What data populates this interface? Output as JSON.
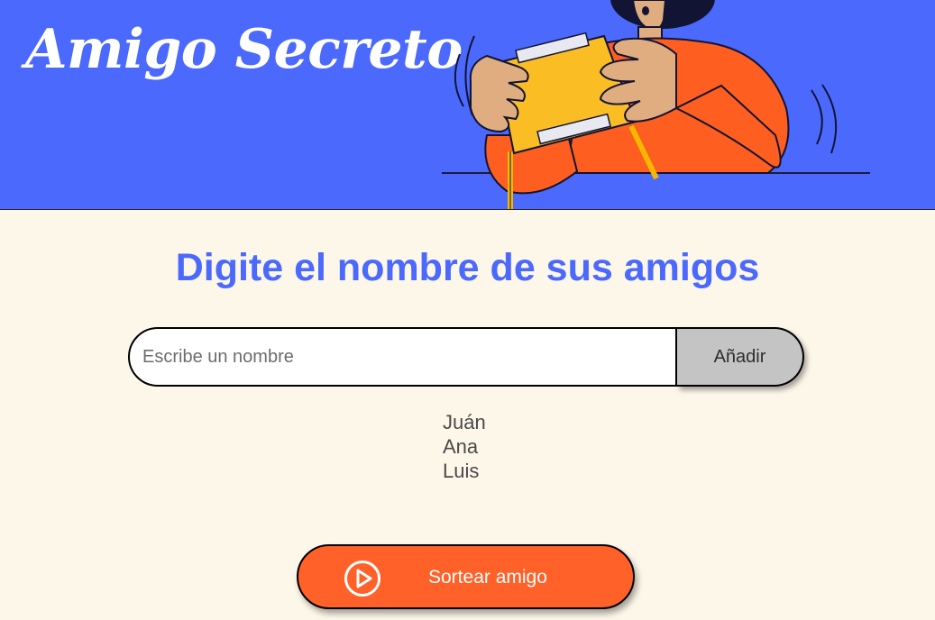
{
  "header": {
    "title": "Amigo Secreto",
    "illustration_icon": "person-holding-gift-illustration",
    "background_color": "#4b69fd"
  },
  "main": {
    "heading": "Digite el nombre de sus amigos",
    "heading_color": "#4b69fd",
    "input": {
      "value": "",
      "placeholder": "Escribe un nombre"
    },
    "add_button_label": "Añadir",
    "friends": [
      "Juán",
      "Ana",
      "Luis"
    ],
    "draw_button": {
      "label": "Sortear amigo",
      "icon": "play-circle-icon",
      "color": "#ff6128"
    }
  },
  "page_background": "#fdf7ea"
}
